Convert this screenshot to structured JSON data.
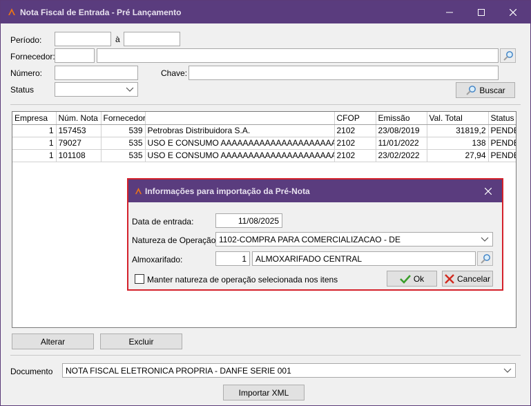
{
  "window": {
    "title": "Nota Fiscal de Entrada - Pré Lançamento",
    "controls": {
      "minimize": "—",
      "maximize": "☐",
      "close": "✕"
    }
  },
  "filters": {
    "periodo_label": "Período:",
    "periodo_from": "",
    "periodo_sep": "à",
    "periodo_to": "",
    "fornecedor_label": "Fornecedor:",
    "fornecedor_code": "",
    "fornecedor_name": "",
    "numero_label": "Número:",
    "numero_value": "",
    "chave_label": "Chave:",
    "chave_value": "",
    "status_label": "Status",
    "status_value": "",
    "buscar_label": "Buscar"
  },
  "table": {
    "columns": [
      "Empresa",
      "Núm. Nota",
      "Fornecedor",
      "",
      "CFOP",
      "Emissão",
      "Val. Total",
      "Status"
    ],
    "rows": [
      [
        "1",
        "157453",
        "539",
        "Petrobras Distribuidora S.A.",
        "2102",
        "23/08/2019",
        "31819,2",
        "PENDEN"
      ],
      [
        "1",
        "79027",
        "535",
        "USO E CONSUMO AAAAAAAAAAAAAAAAAAAAAAAAAAA",
        "2102",
        "11/01/2022",
        "138",
        "PENDEN"
      ],
      [
        "1",
        "101108",
        "535",
        "USO E CONSUMO AAAAAAAAAAAAAAAAAAAAAAAAAAA",
        "2102",
        "23/02/2022",
        "27,94",
        "PENDEN"
      ]
    ]
  },
  "actions": {
    "alterar": "Alterar",
    "excluir": "Excluir"
  },
  "documento": {
    "label": "Documento",
    "value": "NOTA FISCAL ELETRONICA PROPRIA - DANFE SERIE 001"
  },
  "importar_xml": "Importar XML",
  "dialog": {
    "title": "Informações para importação da Pré-Nota",
    "data_entrada_label": "Data de entrada:",
    "data_entrada_value": "11/08/2025",
    "natureza_label": "Natureza de Operação:",
    "natureza_value": "1102-COMPRA PARA COMERCIALIZACAO - DE",
    "almox_label": "Almoxarifado:",
    "almox_code": "1",
    "almox_name": "ALMOXARIFADO CENTRAL",
    "manter_label": "Manter natureza de operação selecionada nos itens",
    "ok_label": "Ok",
    "cancelar_label": "Cancelar"
  },
  "colors": {
    "titlebar": "#5a3c7e",
    "dialog_border": "#d4202a"
  }
}
